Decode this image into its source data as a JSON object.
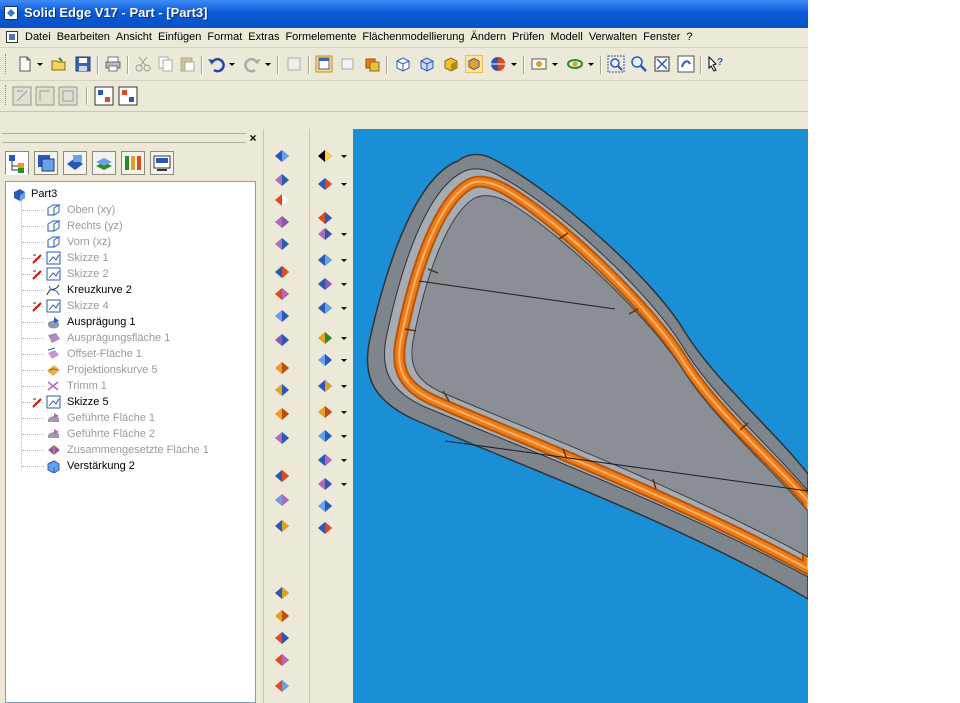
{
  "window": {
    "title": "Solid Edge V17 - Part - [Part3]"
  },
  "menu": [
    "Datei",
    "Bearbeiten",
    "Ansicht",
    "Einfügen",
    "Format",
    "Extras",
    "Formelemente",
    "Flächenmodellierung",
    "Ändern",
    "Prüfen",
    "Modell",
    "Verwalten",
    "Fenster",
    "?"
  ],
  "panel": {
    "close_label": "×",
    "tree": [
      {
        "label": "Part3",
        "icon": "part-icon",
        "state": "normal"
      },
      {
        "label": "Oben (xy)",
        "icon": "plane-icon",
        "state": "hidden"
      },
      {
        "label": "Rechts (yz)",
        "icon": "plane-icon",
        "state": "hidden"
      },
      {
        "label": "Vorn (xz)",
        "icon": "plane-icon",
        "state": "hidden"
      },
      {
        "label": "Skizze 1",
        "icon": "sketch-icon",
        "state": "hidden"
      },
      {
        "label": "Skizze 2",
        "icon": "sketch-icon",
        "state": "hidden"
      },
      {
        "label": "Kreuzkurve 2",
        "icon": "curve-icon",
        "state": "normal"
      },
      {
        "label": "Skizze 4",
        "icon": "sketch-icon",
        "state": "hidden"
      },
      {
        "label": "Ausprägung 1",
        "icon": "protrusion-icon",
        "state": "normal"
      },
      {
        "label": "Ausprägungsfläche 1",
        "icon": "surface-icon",
        "state": "hidden"
      },
      {
        "label": "Offset-Fläche 1",
        "icon": "offset-surface-icon",
        "state": "hidden"
      },
      {
        "label": "Projektionskurve 5",
        "icon": "projection-curve-icon",
        "state": "hidden"
      },
      {
        "label": "Trimm 1",
        "icon": "trim-icon",
        "state": "hidden"
      },
      {
        "label": "Skizze 5",
        "icon": "sketch-icon",
        "state": "normal"
      },
      {
        "label": "Geführte Fläche 1",
        "icon": "swept-surface-icon",
        "state": "hidden"
      },
      {
        "label": "Geführte Fläche 2",
        "icon": "swept-surface-icon",
        "state": "hidden"
      },
      {
        "label": "Zusammengesetzte Fläche 1",
        "icon": "stitched-surface-icon",
        "state": "hidden"
      },
      {
        "label": "Verstärkung 2",
        "icon": "thicken-icon",
        "state": "normal"
      }
    ]
  },
  "colors": {
    "viewport": "#1b8fd6",
    "model_edge": "#f07a16",
    "model_face": "#8a8f96",
    "title_bar": "#0a5ad8"
  }
}
